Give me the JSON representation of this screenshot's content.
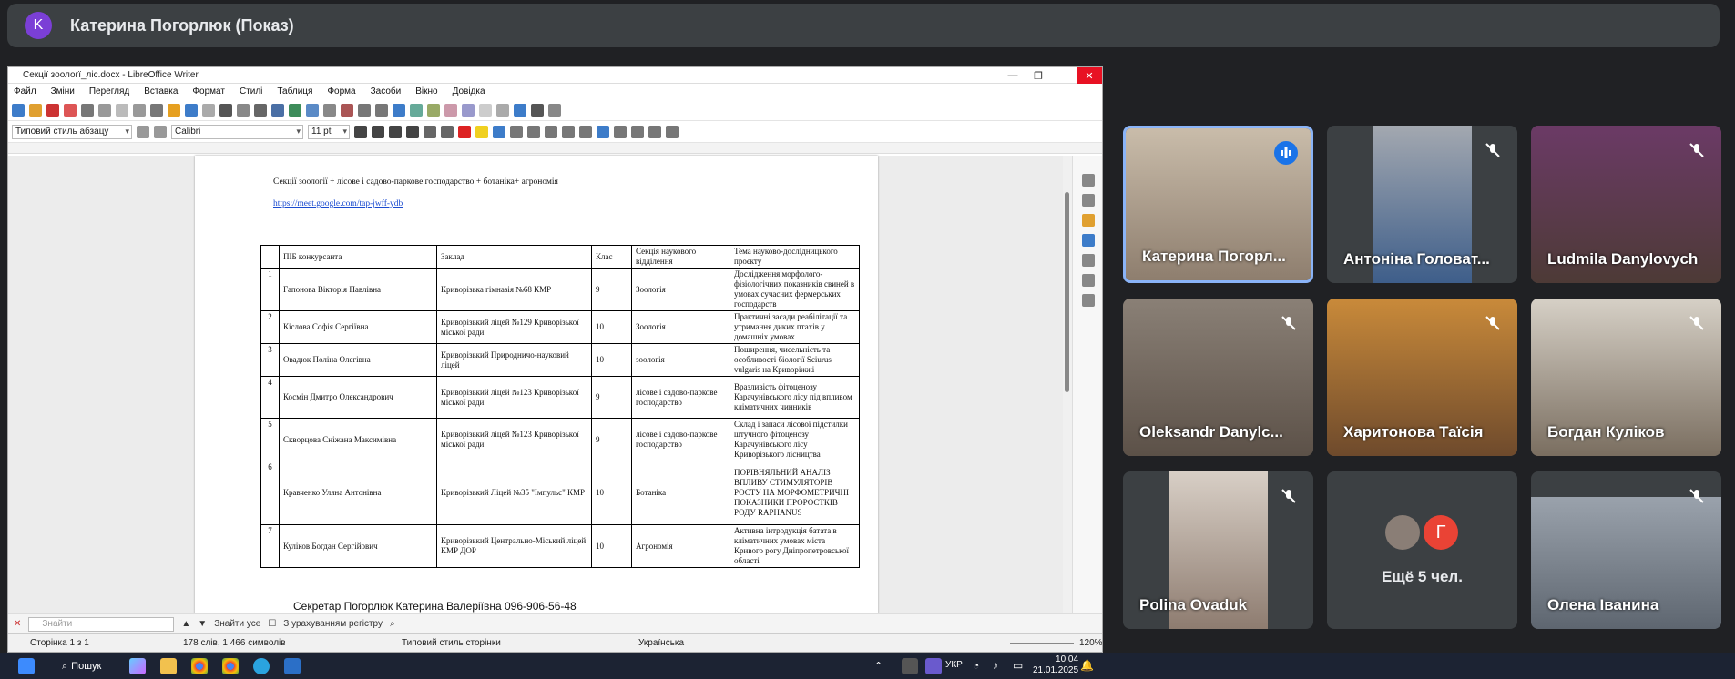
{
  "meet": {
    "avatar_letter": "K",
    "presenter_title": "Катерина Погорлюк (Показ)"
  },
  "libreoffice": {
    "window_title": "Секції зоологї_ліс.docx - LibreOffice Writer",
    "menu": [
      "Файл",
      "Зміни",
      "Перегляд",
      "Вставка",
      "Формат",
      "Стилі",
      "Таблиця",
      "Форма",
      "Засоби",
      "Вікно",
      "Довідка"
    ],
    "para_style": "Типовий стиль абзацу",
    "font_name": "Calibri",
    "font_size": "11 pt",
    "document": {
      "heading": "Секції зоології + лісове і садово-паркове господарство + ботаніка+ агрономія",
      "link": "https://meet.google.com/tap-jwff-ydb",
      "table_header": [
        "",
        "ПІБ конкурсанта",
        "Заклад",
        "Клас",
        "Секція наукового відділення",
        "Тема науково-дослідницького проєкту"
      ],
      "rows": [
        [
          "1",
          "Гапонова Вікторія Павлівна",
          "Криворізька гімназія №68 КМР",
          "9",
          "Зоологія",
          "Дослідження морфолого-фізіологічних показників свиней в умовах сучасних фермерських господарств"
        ],
        [
          "2",
          "Кіслова Софія Сергіївна",
          "Криворізький ліцей №129 Криворізької міської ради",
          "10",
          "Зоологія",
          "Практичні засади реабілітації та утримання диких птахів у домашніх умовах"
        ],
        [
          "3",
          "Овадюк Поліна Олегівна",
          "Криворізький Природничо-науковий ліцей",
          "10",
          "зоологія",
          "Поширення, чисельність та особливості біології Sciurus vulgaris на Криворіжжі"
        ],
        [
          "4",
          "Космін Дмитро Олександрович",
          "Криворізький ліцей №123 Криворізької міської ради",
          "9",
          "лісове і садово-паркове господарство",
          "Вразливість фітоценозу Карачунівського лісу під впливом кліматичних чинників"
        ],
        [
          "5",
          "Скворцова Сніжана Максимівна",
          "Криворізький ліцей №123 Криворізької міської ради",
          "9",
          "лісове і садово-паркове господарство",
          "Склад і запаси лісової підстилки штучного фітоценозу Карачунівського лісу Криворізького лісництва"
        ],
        [
          "6",
          "Кравченко Уляна Антонівна",
          "Криворізький Ліцей №35 \"Імпульс\" КМР",
          "10",
          "Ботаніка",
          "ПОРІВНЯЛЬНИЙ АНАЛІЗ ВПЛИВУ СТИМУЛЯТОРІВ РОСТУ НА МОРФОМЕТРИЧНІ ПОКАЗНИКИ ПРОРОСТКІВ РОДУ RAPHANUS"
        ],
        [
          "7",
          "Куліков Богдан Сергійович",
          "Криворізький Центрально-Міський ліцей КМР ДОР",
          "10",
          "Агрономія",
          "Активна інтродукція батата в кліматичних умовах міста Кривого рогу Дніпропетровської області"
        ]
      ],
      "secretary": "Секретар Погорлюк Катерина Валеріївна  096-906-56-48"
    },
    "find": {
      "placeholder": "Знайти",
      "find_all": "Знайти усе",
      "match_case": "З урахуванням регістру"
    },
    "status": {
      "page": "Сторінка 1 з 1",
      "words": "178 слів, 1 466 символів",
      "page_style": "Типовий стиль сторінки",
      "language": "Українська",
      "zoom": "120%"
    }
  },
  "participants": [
    {
      "name": "Катерина Погорл...",
      "state": "speaking",
      "bg": "#b8a896"
    },
    {
      "name": "Антоніна Головат...",
      "state": "muted",
      "bg": "#8a8f98"
    },
    {
      "name": "Ludmila Danylovych",
      "state": "muted",
      "bg": "#6b5e5a"
    },
    {
      "name": "Oleksandr Danylc...",
      "state": "muted",
      "bg": "#7a706a"
    },
    {
      "name": "Харитонова Таїсія",
      "state": "muted",
      "bg": "#9a6b3c"
    },
    {
      "name": "Богдан Куліков",
      "state": "muted",
      "bg": "#a49a8c"
    },
    {
      "name": "Polina Ovaduk",
      "state": "muted",
      "bg": "#8c7e76"
    },
    {
      "name": "Ещё 5 чел.",
      "state": "more",
      "bg": "#3c4043",
      "badge": "Г"
    },
    {
      "name": "Олена Іванина",
      "state": "muted",
      "bg": "#7e8690"
    }
  ],
  "taskbar": {
    "search_label": "Пошук",
    "lang": "УКР",
    "time": "10:04",
    "date": "21.01.2025"
  }
}
